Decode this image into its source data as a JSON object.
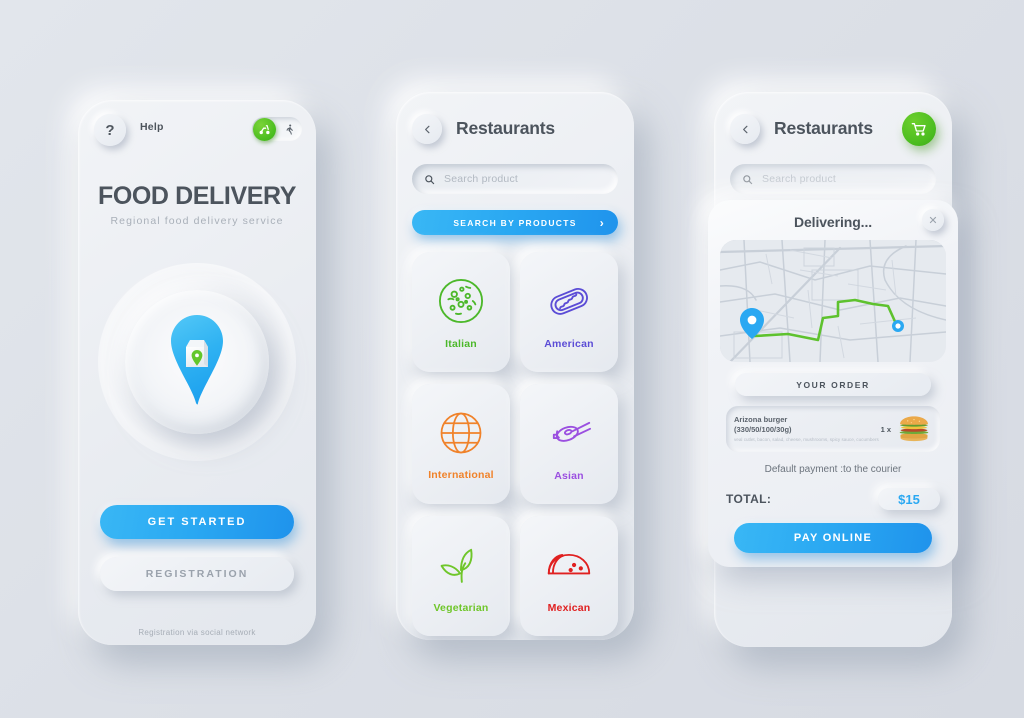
{
  "colors": {
    "accent_blue": "#2aa8f2",
    "accent_green": "#4cbd20",
    "text_dark": "#4c545d",
    "text_muted": "#a9b0b9",
    "bg": "#dde1e7"
  },
  "screen1": {
    "help_icon": "question-mark-icon",
    "help_label": "Help",
    "toggle": {
      "left_icon": "scooter-icon",
      "right_icon": "walking-person-icon",
      "state": "left"
    },
    "title": "FOOD DELIVERY",
    "subtitle": "Regional  food  delivery service",
    "hero_icon": "map-pin-food-bag-icon",
    "primary_button": "GET  STARTED",
    "secondary_button": "REGISTRATION",
    "footer_note": "Registration via social network"
  },
  "screen2": {
    "back_icon": "chevron-left-icon",
    "title": "Restaurants",
    "search": {
      "icon": "search-icon",
      "placeholder": "Search product",
      "value": ""
    },
    "search_products_button": "SEARCH BY PRODUCTS",
    "search_products_chevron": "chevron-right-icon",
    "categories": [
      {
        "label": "Italian",
        "icon": "pizza-icon",
        "color": "#4cb82a"
      },
      {
        "label": "American",
        "icon": "hotdog-icon",
        "color": "#5b4cd6"
      },
      {
        "label": "International",
        "icon": "globe-icon",
        "color": "#f0822a"
      },
      {
        "label": "Asian",
        "icon": "sushi-rolls-icon",
        "color": "#9b4fe0"
      },
      {
        "label": "Vegetarian",
        "icon": "leaf-sprout-icon",
        "color": "#6fc62a"
      },
      {
        "label": "Mexican",
        "icon": "taco-icon",
        "color": "#e02020"
      }
    ]
  },
  "screen3": {
    "back_icon": "chevron-left-icon",
    "title": "Restaurants",
    "cart_icon": "shopping-cart-icon",
    "search": {
      "icon": "search-icon",
      "placeholder": "Search product",
      "value": ""
    },
    "panel": {
      "title": "Delivering...",
      "close_icon": "close-x-icon",
      "map": {
        "pin_icon": "map-pin-icon",
        "destination_icon": "destination-dot-icon",
        "route_color": "#5ec22e"
      },
      "order_header_button": "YOUR ORDER",
      "order_item": {
        "name": "Arizona burger",
        "weights": "(330/50/100/30g)",
        "ingredients": "veal cutlet, bacon, salad, cheese, mushrooms, spicy sauce, cucumbers",
        "quantity": "1 x",
        "image": "burger-photo"
      },
      "payment_note": "Default payment :to the courier",
      "total_label": "TOTAL:",
      "total_value": "$15",
      "pay_button": "PAY ONLINE"
    }
  }
}
